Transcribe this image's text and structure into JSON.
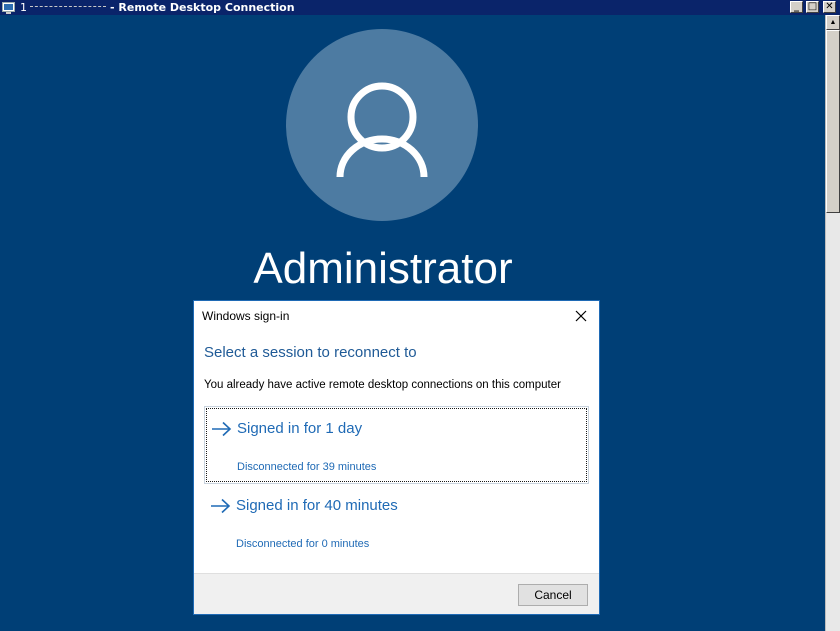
{
  "window": {
    "title_prefix": "1",
    "title": "- Remote Desktop Connection",
    "minimize_symbol": "_",
    "maximize_symbol": "□",
    "close_symbol": "✕"
  },
  "lock_screen": {
    "user_name": "Administrator",
    "avatar_icon": "user-icon",
    "background_color": "#003f76",
    "avatar_color": "#4d7ba2"
  },
  "dialog": {
    "title": "Windows sign-in",
    "heading": "Select a session to reconnect to",
    "description": "You already have active remote desktop connections on this computer",
    "sessions": [
      {
        "title": "Signed in for 1 day",
        "status": "Disconnected for 39 minutes",
        "selected": true
      },
      {
        "title": "Signed in for 40 minutes",
        "status": "Disconnected for 0 minutes",
        "selected": false
      }
    ],
    "cancel_label": "Cancel",
    "accent_color": "#1f6ab5"
  }
}
